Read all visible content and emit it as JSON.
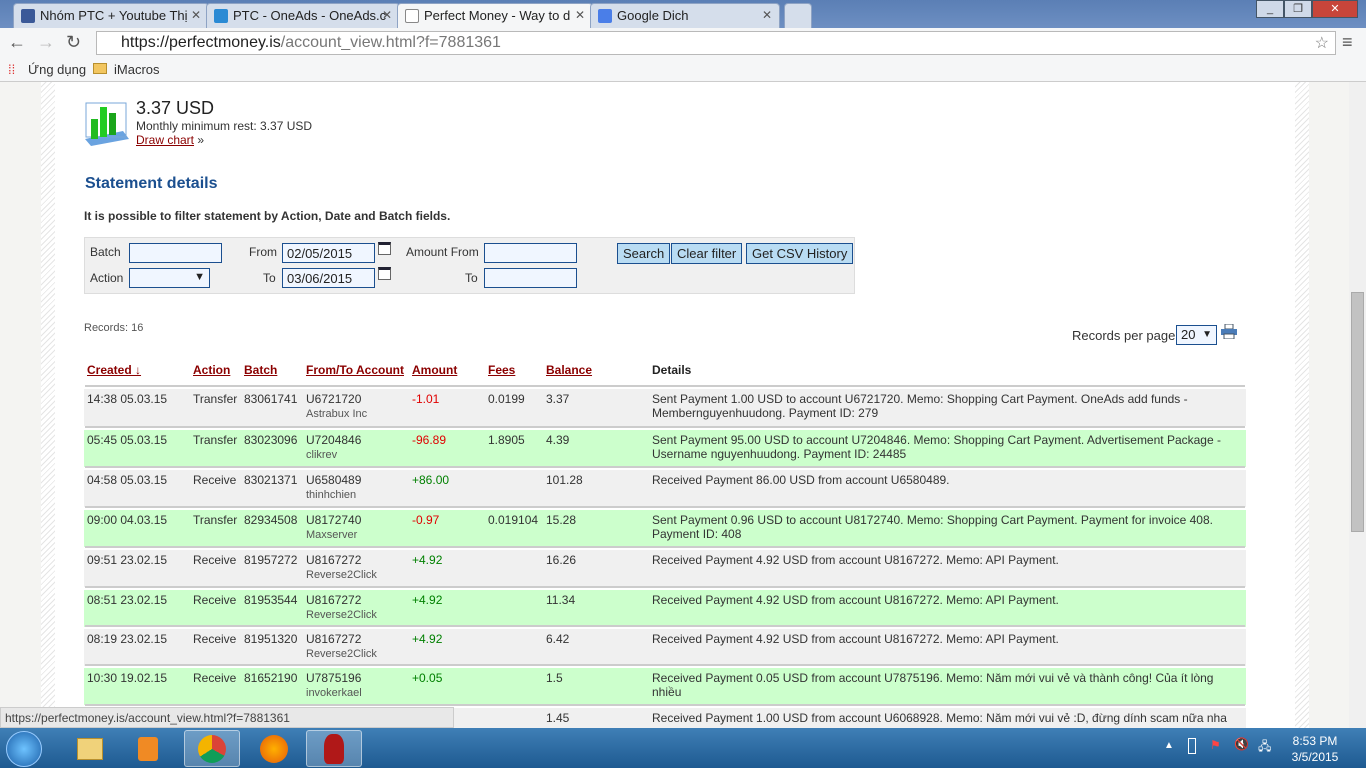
{
  "browser": {
    "tabs": [
      {
        "title": "Nhóm PTC + Youtube Thị",
        "color": "#3b5998"
      },
      {
        "title": "PTC - OneAds - OneAds.c",
        "color": "#2a8ad4"
      },
      {
        "title": "Perfect Money - Way to d",
        "color": "#ffffff"
      },
      {
        "title": "Google Dich",
        "color": "#4a7ee8"
      }
    ],
    "url_host": "https://perfectmoney.is",
    "url_path": "/account_view.html?f=7881361",
    "bookmarks": [
      "Ứng dụng",
      "iMacros"
    ],
    "status_url": "https://perfectmoney.is/account_view.html?f=7881361"
  },
  "balance": {
    "amount": "3.37 USD",
    "min_rest": "Monthly minimum rest: 3.37 USD",
    "draw_chart": "Draw chart",
    "arrow": "»"
  },
  "statement": {
    "title": "Statement details",
    "hint": "It is possible to filter statement by Action, Date and Batch fields."
  },
  "filter": {
    "batch_label": "Batch",
    "action_label": "Action",
    "from_label": "From",
    "to_label": "To",
    "from_value": "02/05/2015",
    "to_value": "03/06/2015",
    "amount_from_label": "Amount From",
    "amount_to_label": "To",
    "search": "Search",
    "clear": "Clear filter",
    "csv": "Get CSV History"
  },
  "records": "Records: 16",
  "per_page_label": "Records per page:",
  "per_page": "20",
  "columns": [
    "Created ↓",
    "Action",
    "Batch",
    "From/To Account",
    "Amount",
    "Fees",
    "Balance",
    "Details"
  ],
  "rows": [
    [
      "14:38 05.03.15",
      "Transfer",
      "83061741",
      "U6721720",
      "Astrabux Inc",
      "-1.01",
      "0.0199",
      "3.37",
      "Sent Payment 1.00 USD to account U6721720. Memo: Shopping Cart Payment. OneAds add funds - Membernguyenhuudong. Payment ID: 279"
    ],
    [
      "05:45 05.03.15",
      "Transfer",
      "83023096",
      "U7204846",
      "clikrev",
      "-96.89",
      "1.8905",
      "4.39",
      "Sent Payment 95.00 USD to account U7204846. Memo: Shopping Cart Payment. Advertisement Package - Username nguyenhuudong. Payment ID: 24485"
    ],
    [
      "04:58 05.03.15",
      "Receive",
      "83021371",
      "U6580489",
      "thinhchien",
      "+86.00",
      "",
      "101.28",
      "Received Payment 86.00 USD from account U6580489."
    ],
    [
      "09:00 04.03.15",
      "Transfer",
      "82934508",
      "U8172740",
      "Maxserver",
      "-0.97",
      "0.019104",
      "15.28",
      "Sent Payment 0.96 USD to account U8172740. Memo: Shopping Cart Payment. Payment for invoice 408. Payment ID: 408"
    ],
    [
      "09:51 23.02.15",
      "Receive",
      "81957272",
      "U8167272",
      "Reverse2Click",
      "+4.92",
      "",
      "16.26",
      "Received Payment 4.92 USD from account U8167272. Memo: API Payment."
    ],
    [
      "08:51 23.02.15",
      "Receive",
      "81953544",
      "U8167272",
      "Reverse2Click",
      "+4.92",
      "",
      "11.34",
      "Received Payment 4.92 USD from account U8167272. Memo: API Payment."
    ],
    [
      "08:19 23.02.15",
      "Receive",
      "81951320",
      "U8167272",
      "Reverse2Click",
      "+4.92",
      "",
      "6.42",
      "Received Payment 4.92 USD from account U8167272. Memo: API Payment."
    ],
    [
      "10:30 19.02.15",
      "Receive",
      "81652190",
      "U7875196",
      "invokerkael",
      "+0.05",
      "",
      "1.5",
      "Received Payment 0.05 USD from account U7875196. Memo: Năm mới vui vẻ và thành công! Của ít lòng nhiều"
    ],
    [
      "",
      "",
      "",
      "",
      "",
      "",
      "",
      "1.45",
      "Received Payment 1.00 USD from account U6068928. Memo: Năm mới vui vẻ :D, đừng dính scam nữa nha :"
    ]
  ],
  "colors": {
    "row_odd": "#f0f0f0",
    "row_even": "#ccffcc",
    "negative": "#e00000",
    "positive": "#008000",
    "heading": "#1b4f8f"
  },
  "taskbar": {
    "time": "8:53 PM",
    "date": "3/5/2015"
  }
}
